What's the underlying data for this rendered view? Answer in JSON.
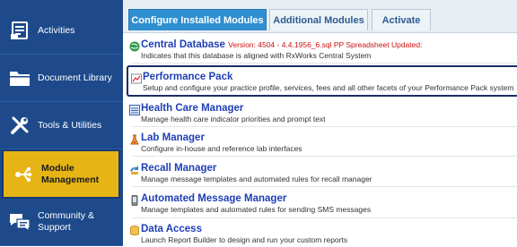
{
  "sidebar": {
    "items": [
      {
        "label": "Activities",
        "icon": "activities-icon"
      },
      {
        "label": "Document Library",
        "icon": "folder-icon"
      },
      {
        "label": "Tools & Utilities",
        "icon": "tools-icon"
      },
      {
        "label": "Module Management",
        "icon": "module-icon",
        "active": true
      },
      {
        "label": "Community & Support",
        "icon": "community-icon"
      }
    ],
    "colors": {
      "background": "#1e4a8b",
      "active": "#e6b515"
    }
  },
  "tabs": [
    {
      "label": "Configure Installed Modules",
      "active": true
    },
    {
      "label": "Additional Modules",
      "active": false
    },
    {
      "label": "Activate",
      "active": false
    }
  ],
  "modules": [
    {
      "title": "Central Database",
      "version": "Version: 4504 - 4.4.1956_6.sql PP Spreadsheet Updated:",
      "desc": "Indicates that this database is aligned with RxWorks Central System",
      "icon": "globe-icon"
    },
    {
      "title": "Performance Pack",
      "desc": "Setup and configure your practice profile, services, fees and all other facets of your Performance Pack system",
      "icon": "chart-icon",
      "selected": true
    },
    {
      "title": "Health Care Manager",
      "desc": "Manage health care indicator priorities and prompt text",
      "icon": "list-icon"
    },
    {
      "title": "Lab Manager",
      "desc": "Configure in-house and reference lab interfaces",
      "icon": "flask-icon"
    },
    {
      "title": "Recall Manager",
      "desc": "Manage message templates and automated rules for recall manager",
      "icon": "recall-icon"
    },
    {
      "title": "Automated Message Manager",
      "desc": "Manage templates and automated rules for sending SMS messages",
      "icon": "phone-icon"
    },
    {
      "title": "Data Access",
      "desc": "Launch Report Builder to design and run your custom reports",
      "icon": "database-icon"
    }
  ]
}
